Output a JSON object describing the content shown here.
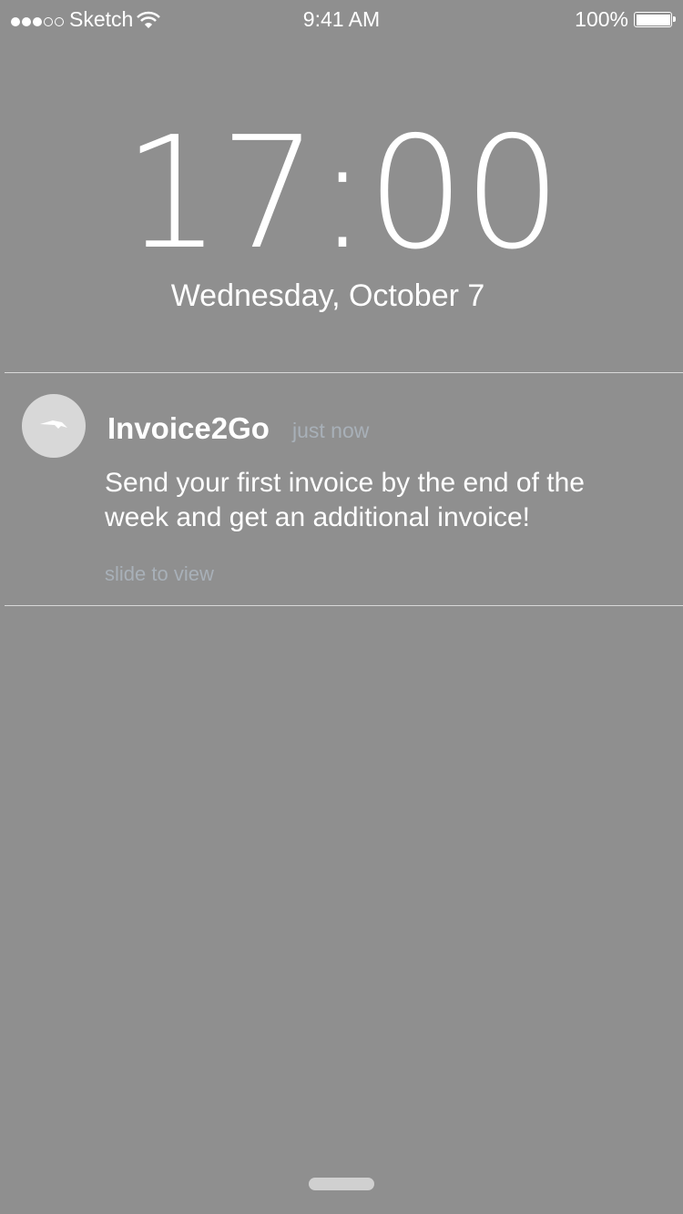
{
  "status_bar": {
    "carrier": "Sketch",
    "signal_bars": 3,
    "signal_max": 5,
    "time": "9:41 AM",
    "battery": "100%",
    "battery_level": 1.0
  },
  "lock": {
    "time": "17:00",
    "date": "Wednesday, October 7"
  },
  "notification": {
    "app": "Invoice2Go",
    "when": "just now",
    "message": "Send your first invoice by the end of the week and get an additional invoice!",
    "hint": "slide to view",
    "icon": "invoice2go-bird-icon"
  }
}
